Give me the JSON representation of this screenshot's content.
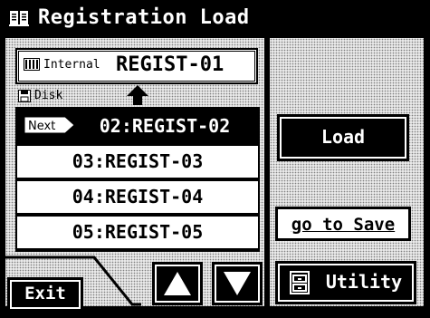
{
  "window": {
    "title": "Registration Load"
  },
  "current": {
    "source_label": "Internal",
    "name": "REGIST-01"
  },
  "disk": {
    "label": "Disk"
  },
  "list": {
    "next_tag": "Next",
    "items": [
      {
        "label": "02:REGIST-02",
        "selected": true
      },
      {
        "label": "03:REGIST-03",
        "selected": false
      },
      {
        "label": "04:REGIST-04",
        "selected": false
      },
      {
        "label": "05:REGIST-05",
        "selected": false
      }
    ]
  },
  "buttons": {
    "load": "Load",
    "save": "go to Save",
    "utility": "Utility",
    "exit": "Exit"
  },
  "icons": {
    "title": "book-icon",
    "internal": "keyboard-icon",
    "disk": "floppy-disk-icon",
    "arrow": "up-arrow-icon",
    "scroll_up": "triangle-up-icon",
    "scroll_down": "triangle-down-icon",
    "utility": "cabinet-icon"
  }
}
